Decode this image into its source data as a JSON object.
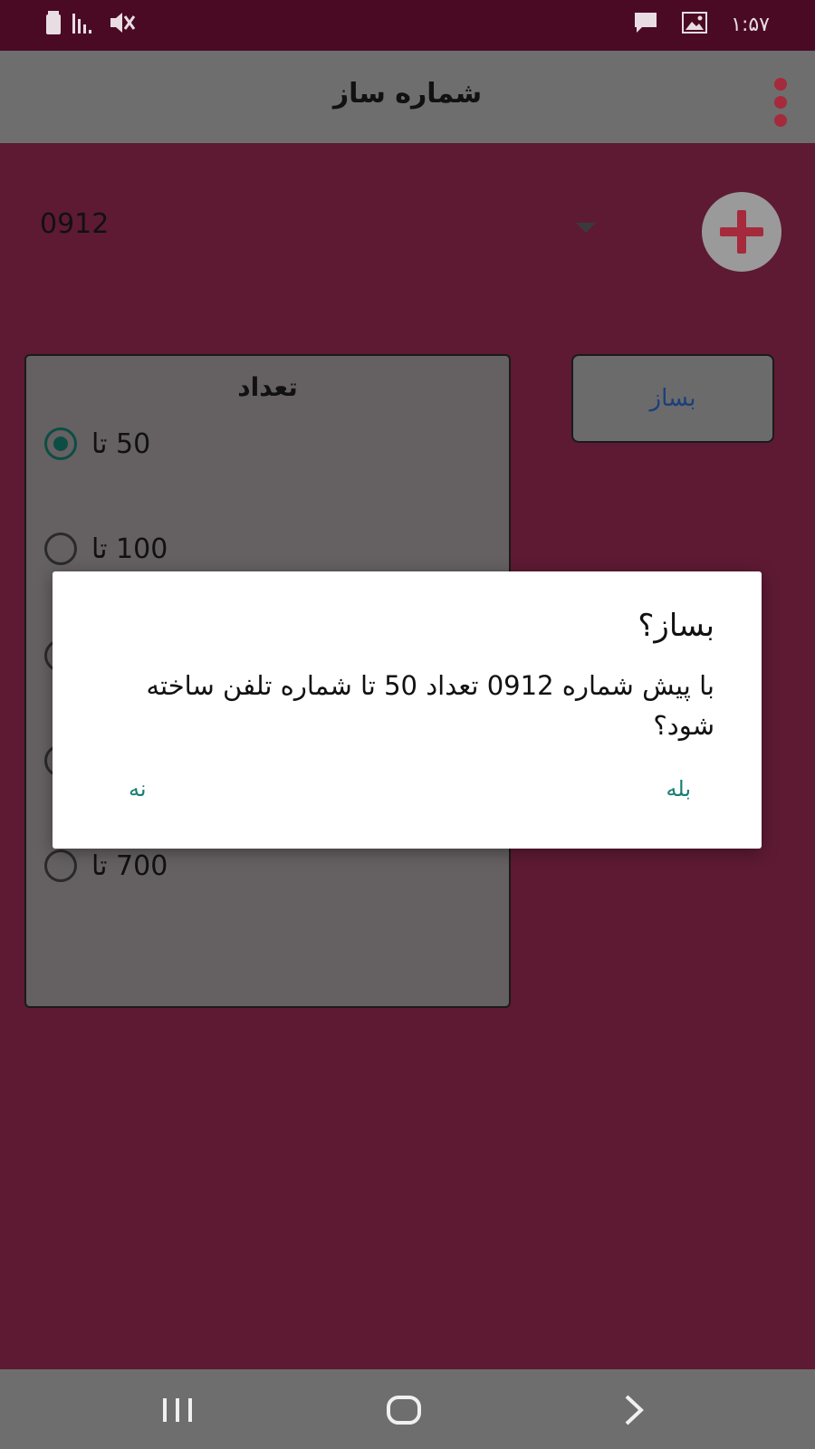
{
  "status_bar": {
    "time": "۱:۵۷",
    "left_icons": [
      "battery-icon",
      "signal-icon",
      "mute-icon"
    ],
    "right_icons": [
      "message-icon",
      "image-icon"
    ]
  },
  "app_bar": {
    "title": "شماره ساز",
    "menu_icon": "kebab-menu-icon"
  },
  "prefix_spinner": {
    "selected": "0912"
  },
  "count_panel": {
    "title": "تعداد",
    "options": [
      {
        "label": "50 تا",
        "checked": true
      },
      {
        "label": "100 تا",
        "checked": false
      },
      {
        "label": "700 تا",
        "checked": false
      }
    ]
  },
  "build_button": {
    "label": "بساز"
  },
  "dialog": {
    "title": "بساز؟",
    "message": "با پیش شماره 0912 تعداد 50 تا شماره تلفن ساخته شود؟",
    "yes_label": "بله",
    "no_label": "نه"
  },
  "nav_bar": {
    "icons": [
      "recent-apps-icon",
      "home-icon",
      "back-icon"
    ]
  },
  "colors": {
    "background": "#5e1a33",
    "status_bar": "#4a0a24",
    "app_bar": "#6e6e6e",
    "accent": "#167e72",
    "radio_checked": "#0d4d44",
    "add_icon": "#a52a3c"
  }
}
